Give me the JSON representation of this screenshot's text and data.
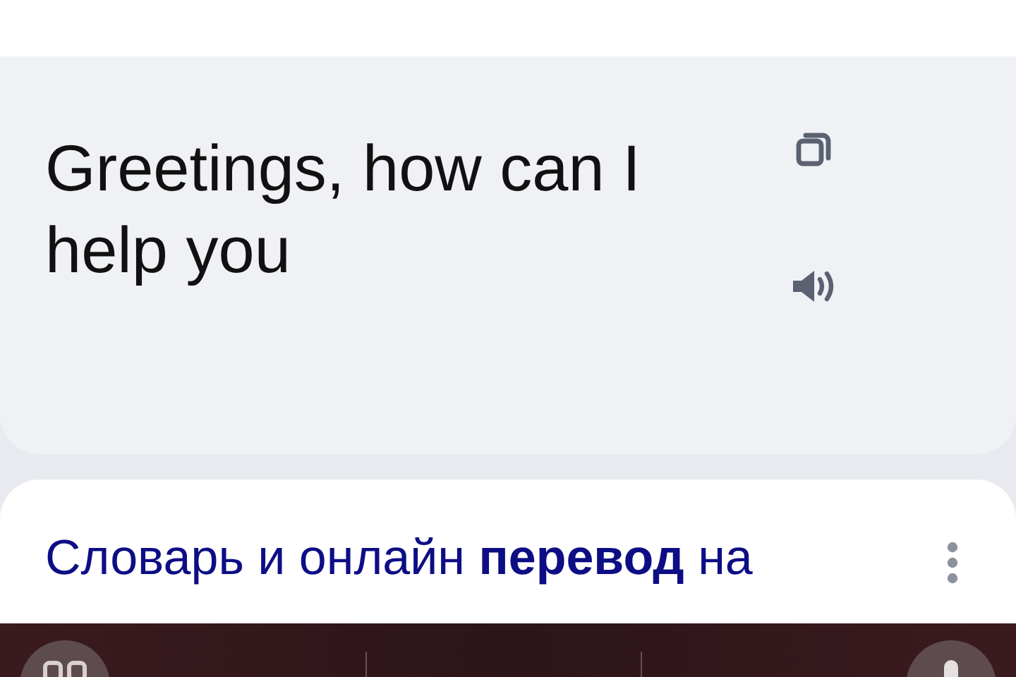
{
  "translation": {
    "text": "Greetings, how can I help you"
  },
  "result": {
    "title": "Словарь и онлайн **перевод** на"
  }
}
